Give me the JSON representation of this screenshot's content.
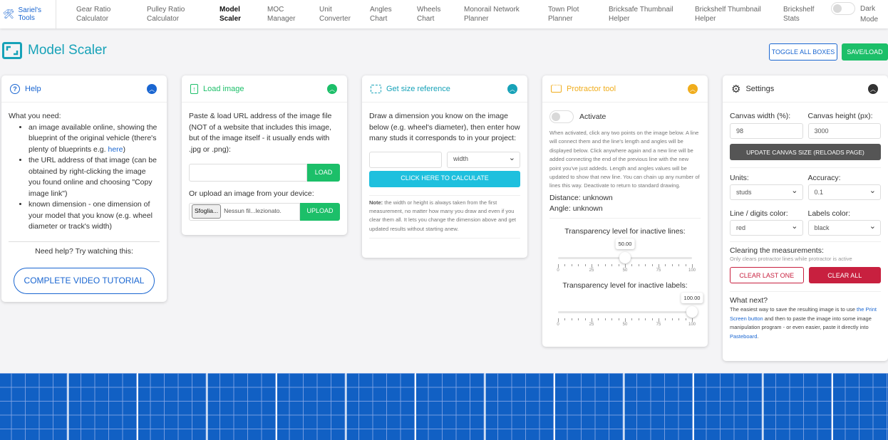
{
  "nav": {
    "brand": "Sariel's Tools",
    "items": [
      [
        "Gear Ratio",
        "Calculator"
      ],
      [
        "Pulley Ratio",
        "Calculator"
      ],
      [
        "Model",
        "Scaler"
      ],
      [
        "MOC",
        "Manager"
      ],
      [
        "Unit",
        "Converter"
      ],
      [
        "Angles",
        "Chart"
      ],
      [
        "Wheels",
        "Chart"
      ],
      [
        "Monorail Network",
        "Planner"
      ],
      [
        "Town Plot",
        "Planner"
      ],
      [
        "Bricksafe Thumbnail",
        "Helper"
      ],
      [
        "Brickshelf Thumbnail",
        "Helper"
      ],
      [
        "Brickshelf",
        "Stats"
      ]
    ],
    "active": 2,
    "dark_mode": [
      "Dark",
      "Mode"
    ],
    "dark_mode_on": false
  },
  "page": {
    "title": "Model Scaler",
    "toggle_all": "Toggle all boxes",
    "save_load": "Save/Load"
  },
  "help": {
    "title": "Help",
    "intro": "What you need:",
    "bullets": [
      "an image available online, showing the blueprint of the original vehicle (there's plenty of blueprints e.g. ",
      "the URL address of that image (can be obtained by right-clicking the image you found online and choosing \"Copy image link\")",
      "known dimension - one dimension of your model that you know (e.g. wheel diameter or track's width)"
    ],
    "here_link": "here",
    "here_suffix": ")",
    "need_help": "Need help? Try watching this:",
    "video_button": "Complete video tutorial"
  },
  "load": {
    "title": "Load image",
    "desc": "Paste & load URL address of the image file (NOT of a website that includes this image, but of the image itself - it usually ends with .jpg or .png):",
    "url_value": "",
    "load_button": "Load",
    "upload_label": "Or upload an image from your device:",
    "browse": "Sfoglia...",
    "no_file": "Nessun fil...lezionato.",
    "upload_button": "Upload"
  },
  "size": {
    "title": "Get size reference",
    "desc": "Draw a dimension you know on the image below (e.g. wheel's diameter), then enter how many studs it corresponds to in your project:",
    "value": "",
    "dimension": "width",
    "calc_button": "Click here to calculate",
    "note_bold": "Note:",
    "note": " the width or height is always taken from the first measurement, no matter how many you draw and even if you clear them all. It lets you change the dimension above and get updated results without starting anew."
  },
  "protractor": {
    "title": "Protractor tool",
    "activate": "Activate",
    "active": false,
    "desc": "When activated, click any two points on the image below. A line will connect them and the line's length and angles will be displayed below. Click anywhere again and a new line will be added connecting the end of the previous line with the new point you've just addeds. Length and angles values will be updated to show that new line. You can chain up any number of lines this way. Deactivate to return to standard drawing.",
    "distance": "Distance: unknown",
    "angle": "Angle: unknown",
    "lines_label": "Transparency level for inactive lines:",
    "lines_value": "50.00",
    "lines_level": 50,
    "labels_label": "Transparency level for inactive labels:",
    "labels_value": "100.00",
    "labels_level": 100,
    "ticks": [
      "0",
      "25",
      "50",
      "75",
      "100"
    ]
  },
  "settings": {
    "title": "Settings",
    "canvas_width_label": "Canvas width (%):",
    "canvas_width": "98",
    "canvas_height_label": "Canvas height (px):",
    "canvas_height": "3000",
    "update_button": "Update canvas size (reloads page)",
    "units_label": "Units:",
    "units": "studs",
    "accuracy_label": "Accuracy:",
    "accuracy": "0.1",
    "line_color_label": "Line / digits color:",
    "line_color": "red",
    "labels_color_label": "Labels color:",
    "labels_color": "black",
    "clearing_label": "Clearing the measurements:",
    "clearing_note": "Only clears protractor lines while protractor is active",
    "clear_last": "Clear last one",
    "clear_all": "Clear all",
    "next_label": "What next?",
    "next_1": "The easiest way to save the resulting image is to use ",
    "next_link1": "the Print Screen button",
    "next_2": " and then to paste the image into some image manipulation program - or even easier, paste it directly into ",
    "next_link2": "Pasteboard",
    "next_3": "."
  },
  "colors": {
    "primary": "#1a66d1",
    "info": "#17a2b8",
    "success": "#1cbf69",
    "warning": "#f0ad1c",
    "danger": "#c8203f",
    "grid_blue": "#1160c4"
  }
}
